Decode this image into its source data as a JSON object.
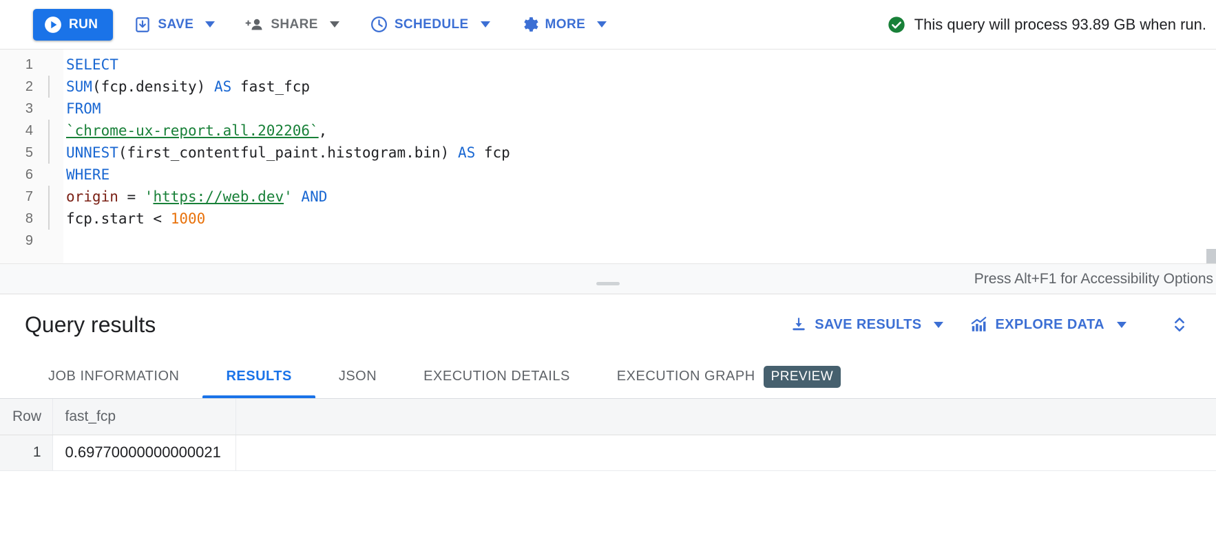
{
  "toolbar": {
    "run_label": "RUN",
    "save_label": "SAVE",
    "share_label": "SHARE",
    "schedule_label": "SCHEDULE",
    "more_label": "MORE",
    "status_text": "This query will process 93.89 GB when run.",
    "status_icon": "check-circle-icon",
    "accent_blue": "#1a73e8",
    "link_blue": "#3c6fd4",
    "status_green": "#188038"
  },
  "editor": {
    "accessibility_hint": "Press Alt+F1 for Accessibility Options",
    "lines": [
      {
        "num": "1",
        "guide": false,
        "tokens": [
          {
            "t": "SELECT",
            "c": "kw"
          }
        ]
      },
      {
        "num": "2",
        "guide": true,
        "tokens": [
          {
            "t": "SUM",
            "c": "fn"
          },
          {
            "t": "(",
            "c": "plain"
          },
          {
            "t": "fcp.density",
            "c": "plain"
          },
          {
            "t": ")",
            "c": "plain"
          },
          {
            "t": " ",
            "c": "plain"
          },
          {
            "t": "AS",
            "c": "kw"
          },
          {
            "t": " fast_fcp",
            "c": "plain"
          }
        ]
      },
      {
        "num": "3",
        "guide": false,
        "tokens": [
          {
            "t": "FROM",
            "c": "kw"
          }
        ]
      },
      {
        "num": "4",
        "guide": true,
        "tokens": [
          {
            "t": "`chrome-ux-report.all.202206`",
            "c": "tbl"
          },
          {
            "t": ",",
            "c": "plain"
          }
        ]
      },
      {
        "num": "5",
        "guide": true,
        "tokens": [
          {
            "t": "UNNEST",
            "c": "fn"
          },
          {
            "t": "(first_contentful_paint.histogram.bin)",
            "c": "plain"
          },
          {
            "t": " ",
            "c": "plain"
          },
          {
            "t": "AS",
            "c": "kw"
          },
          {
            "t": " fcp",
            "c": "plain"
          }
        ]
      },
      {
        "num": "6",
        "guide": false,
        "tokens": [
          {
            "t": "WHERE",
            "c": "kw"
          }
        ]
      },
      {
        "num": "7",
        "guide": true,
        "tokens": [
          {
            "t": "origin",
            "c": "ident"
          },
          {
            "t": " = ",
            "c": "plain"
          },
          {
            "t": "'",
            "c": "strq"
          },
          {
            "t": "https://web.dev",
            "c": "str"
          },
          {
            "t": "'",
            "c": "strq"
          },
          {
            "t": " ",
            "c": "plain"
          },
          {
            "t": "AND",
            "c": "kw"
          }
        ]
      },
      {
        "num": "8",
        "guide": true,
        "tokens": [
          {
            "t": "fcp.start < ",
            "c": "plain"
          },
          {
            "t": "1000",
            "c": "num"
          }
        ]
      },
      {
        "num": "9",
        "guide": false,
        "tokens": []
      }
    ]
  },
  "results": {
    "title": "Query results",
    "save_results_label": "SAVE RESULTS",
    "explore_data_label": "EXPLORE DATA",
    "expand_icon": "unfold-more-icon",
    "tabs": [
      {
        "label": "JOB INFORMATION",
        "active": false,
        "badge": ""
      },
      {
        "label": "RESULTS",
        "active": true,
        "badge": ""
      },
      {
        "label": "JSON",
        "active": false,
        "badge": ""
      },
      {
        "label": "EXECUTION DETAILS",
        "active": false,
        "badge": ""
      },
      {
        "label": "EXECUTION GRAPH",
        "active": false,
        "badge": "PREVIEW"
      }
    ],
    "table": {
      "columns": [
        "Row",
        "fast_fcp",
        ""
      ],
      "rows": [
        {
          "row": "1",
          "fast_fcp": "0.69770000000000021"
        }
      ]
    }
  }
}
